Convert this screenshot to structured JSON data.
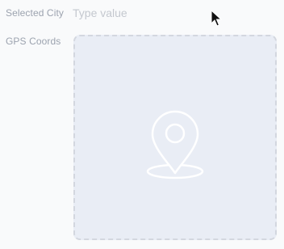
{
  "form": {
    "selected_city": {
      "label": "Selected City",
      "value": "",
      "placeholder": "Type value"
    },
    "gps_coords": {
      "label": "GPS Coords",
      "icon": "map-pin-icon"
    }
  },
  "colors": {
    "background": "#f9fafb",
    "label": "#9ca3af",
    "placeholder": "#c4c8cf",
    "map_fill": "#e9edf5",
    "map_border": "#d3d7df"
  }
}
